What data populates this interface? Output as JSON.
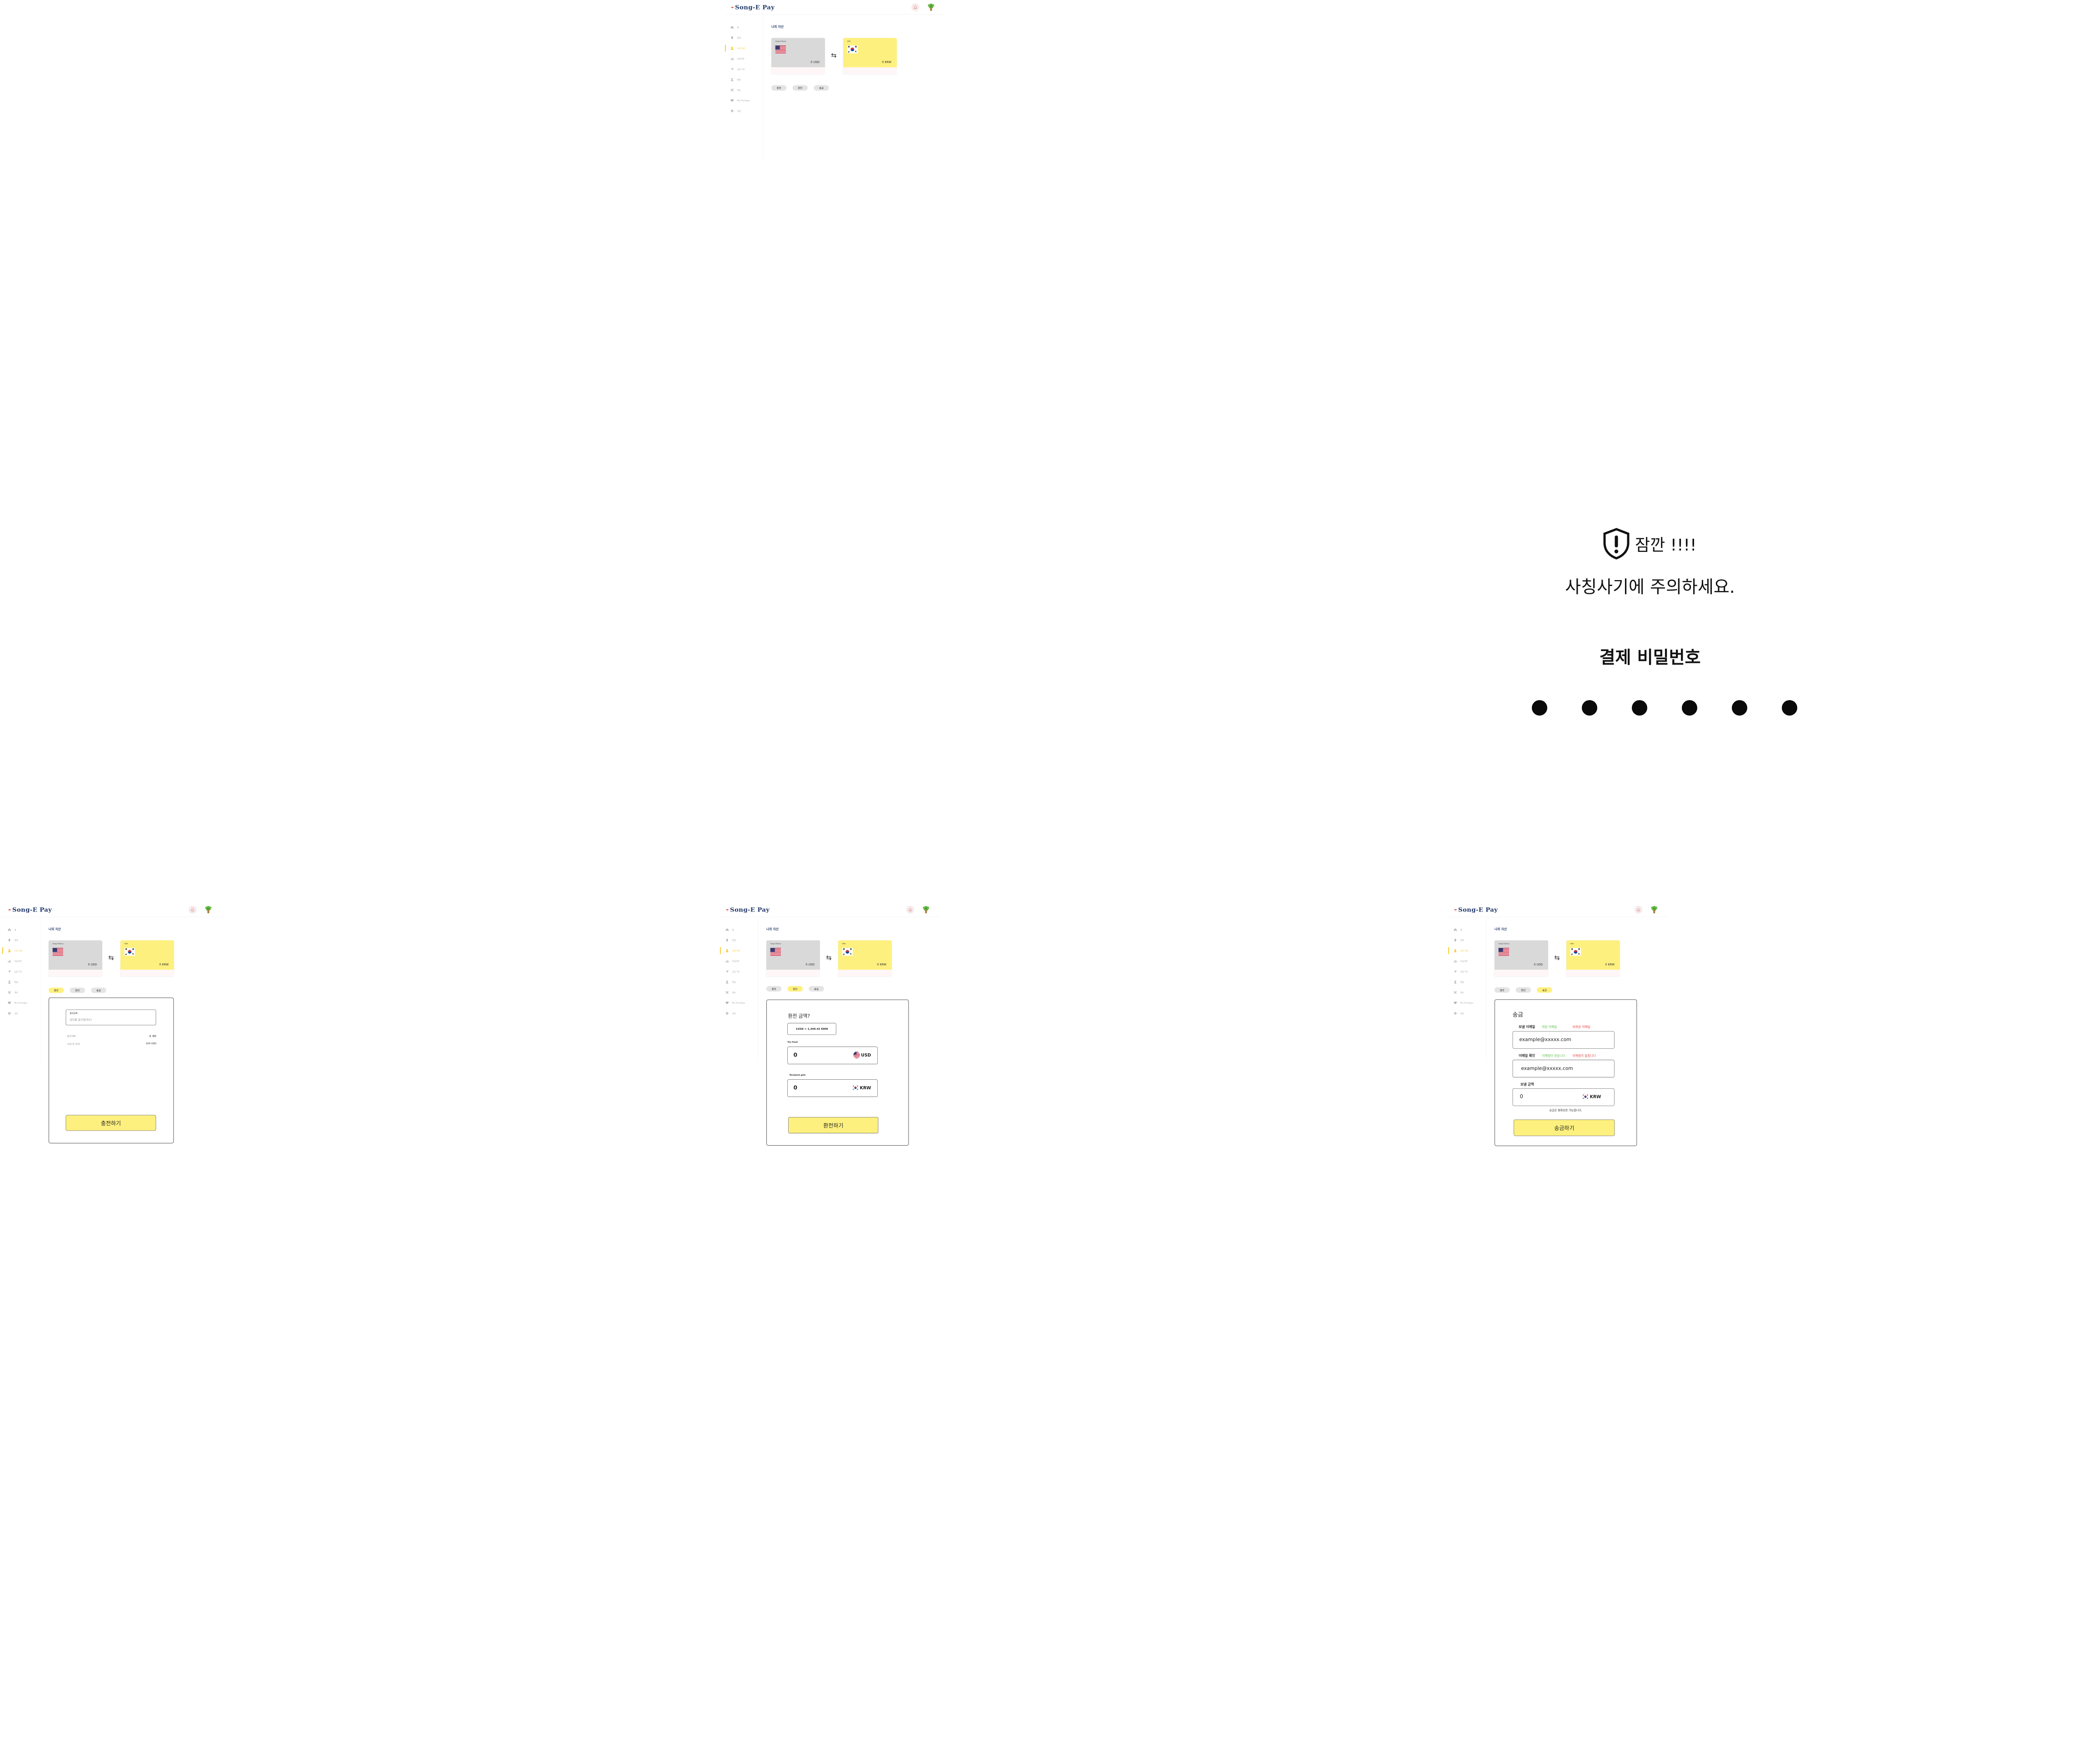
{
  "app": {
    "logo": "Song-E Pay",
    "sidebar": [
      {
        "label": "홈",
        "icon": "home-icon"
      },
      {
        "label": "결제",
        "icon": "payment-icon"
      },
      {
        "label": "나의 자산",
        "icon": "user-icon",
        "active": true
      },
      {
        "label": "이용내역",
        "icon": "history-icon"
      },
      {
        "label": "금융 지도",
        "icon": "navigation-icon"
      },
      {
        "label": "환불",
        "icon": "refund-icon"
      },
      {
        "label": "혜사",
        "icon": "tools-icon"
      },
      {
        "label": "My Privileges",
        "icon": "heart-icon"
      },
      {
        "label": "설정",
        "icon": "gear-icon"
      }
    ],
    "page_title": "나의 자산",
    "usd_card": {
      "name": "Song-E Money",
      "amount": "0 USD"
    },
    "krw_card": {
      "name": "KRW",
      "amount": "0 KRW"
    },
    "tabs": [
      "충전",
      "환전",
      "송금"
    ]
  },
  "charge": {
    "amount_label": "충전금액",
    "amount_placeholder": "얼마를 충전할까요?",
    "account_label": "충전계좌",
    "account_value": "내 계좌",
    "balance_label": "거래 후 잔액",
    "balance_value": "100 USD",
    "button": "충전하기"
  },
  "exchange": {
    "title": "환전 금액?",
    "rate": "1USD = 1,340.42 KRW",
    "send_label": "You Send",
    "send_value": "0",
    "send_currency": "USD",
    "recv_label": "Recipient gets",
    "recv_value": "0",
    "recv_currency": "KRW",
    "button": "환전하기"
  },
  "remit": {
    "title": "송금",
    "email_label": "보낼 이메일",
    "member_email": "회원 이메일",
    "nonmember_email": "비회원 이메일",
    "email_value": "example@xxxxx.com",
    "confirm_label": "이메일 확인",
    "email_match": "이메일이 같습니다",
    "email_mismatch": "이메일이 틀립니다",
    "confirm_value": "example@xxxxx.com",
    "amount_label": "보낼 금액",
    "amount_value": "0",
    "currency": "KRW",
    "note": "송금은 원화로만 가능합니다.",
    "button": "송금하기"
  },
  "warning": {
    "title": "잠깐 !!!!",
    "message": "사칭사기에 주의하세요.",
    "pin_label": "결제 비밀번호",
    "pin_digits_entered": 6
  },
  "colors": {
    "accent": "#fdf07e",
    "brand": "#243a6b",
    "active_nav": "#f5c518",
    "ok": "#5cbf4a",
    "error": "#e54545"
  }
}
